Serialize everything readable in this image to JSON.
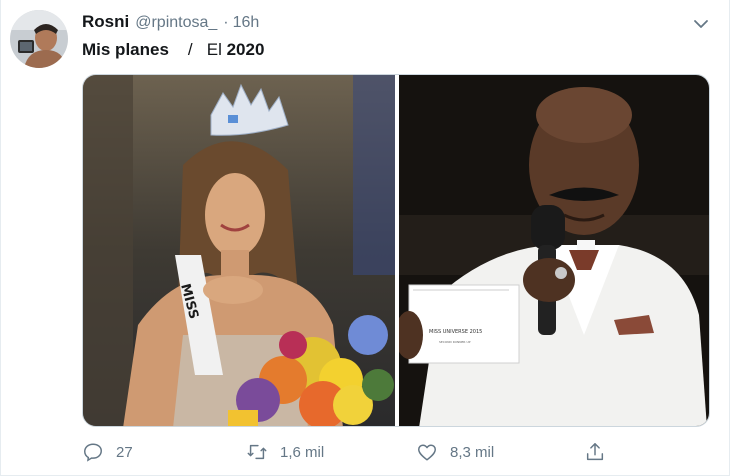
{
  "tweet": {
    "author_name": "Rosni",
    "handle": "@rpintosa_",
    "separator": "·",
    "time": "16h",
    "text_part1": "Mis planes",
    "text_slash": "/",
    "text_part2": "El",
    "text_bold": "2020"
  },
  "card_text": {
    "sash": "MISS",
    "card_title": "MISS UNIVERSE 2015",
    "card_small": "SECOND RUNNER UP"
  },
  "actions": {
    "replies": "27",
    "retweets": "1,6 mil",
    "likes": "8,3 mil"
  },
  "icons": {
    "reply": "reply-icon",
    "retweet": "retweet-icon",
    "like": "heart-icon",
    "share": "share-icon",
    "menu": "chevron-down-icon"
  },
  "colors": {
    "text_primary": "#14171a",
    "text_secondary": "#657786",
    "border": "#ccd6dd"
  }
}
